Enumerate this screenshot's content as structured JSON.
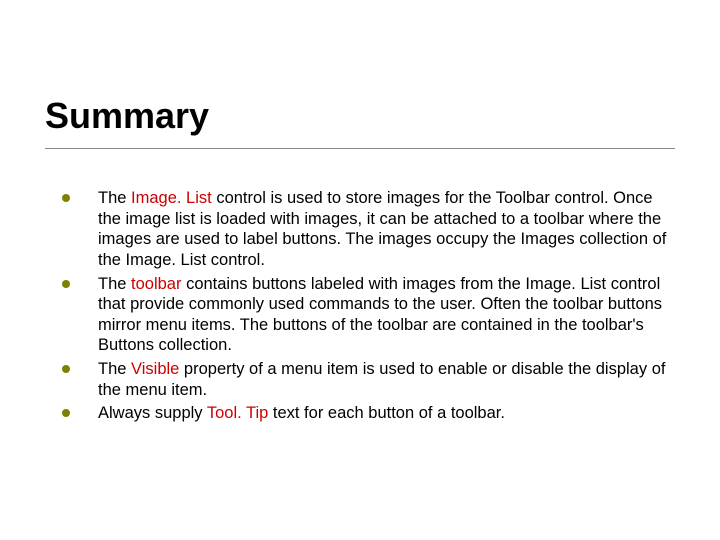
{
  "title": "Summary",
  "bullets": [
    {
      "pre": "The ",
      "highlight": "Image. List",
      "post": " control is used to store images for the Toolbar control. Once the image list is loaded with images, it can be attached to a toolbar where the images are used to label buttons. The images occupy the Images collection of the Image. List control."
    },
    {
      "pre": "The ",
      "highlight": "toolbar",
      "post": " contains buttons labeled with images from the Image. List control that provide commonly used commands to the user. Often the toolbar buttons mirror menu items. The buttons of the toolbar are contained in the toolbar's Buttons collection."
    },
    {
      "pre": "The ",
      "highlight": "Visible",
      "post": " property of a menu item is used to enable or disable the display of the menu item."
    },
    {
      "pre": "Always supply ",
      "highlight": "Tool. Tip",
      "post": " text for each button of a toolbar."
    }
  ]
}
